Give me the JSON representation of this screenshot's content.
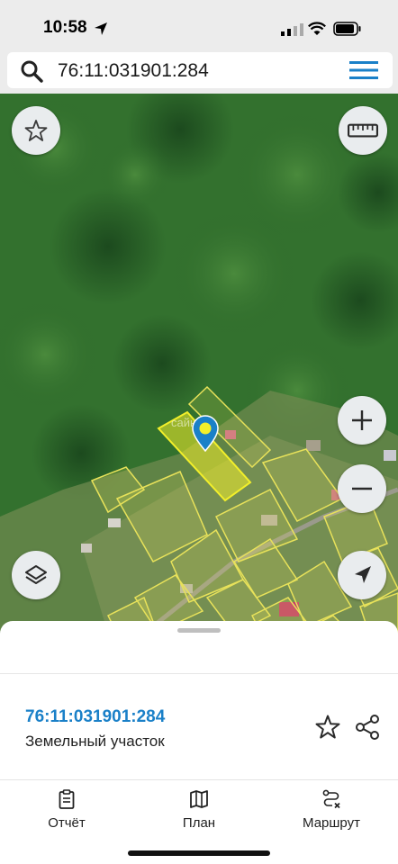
{
  "status": {
    "time": "10:58"
  },
  "search": {
    "query": "76:11:031901:284"
  },
  "map": {
    "buttons": [
      "favorite",
      "ruler",
      "zoom-in",
      "zoom-out",
      "layers",
      "my-location"
    ],
    "watermark": "сайнет плюс"
  },
  "parcel": {
    "number": "76:11:031901:284",
    "type": "Земельный участок"
  },
  "tabs": [
    {
      "label": "Отчёт",
      "icon": "report-icon"
    },
    {
      "label": "План",
      "icon": "map-plan-icon"
    },
    {
      "label": "Маршрут",
      "icon": "route-icon"
    }
  ],
  "colors": {
    "accent": "#1a80c8",
    "parcel_highlight": "#f2ef2a",
    "parcel_outline": "#e8e25a"
  }
}
